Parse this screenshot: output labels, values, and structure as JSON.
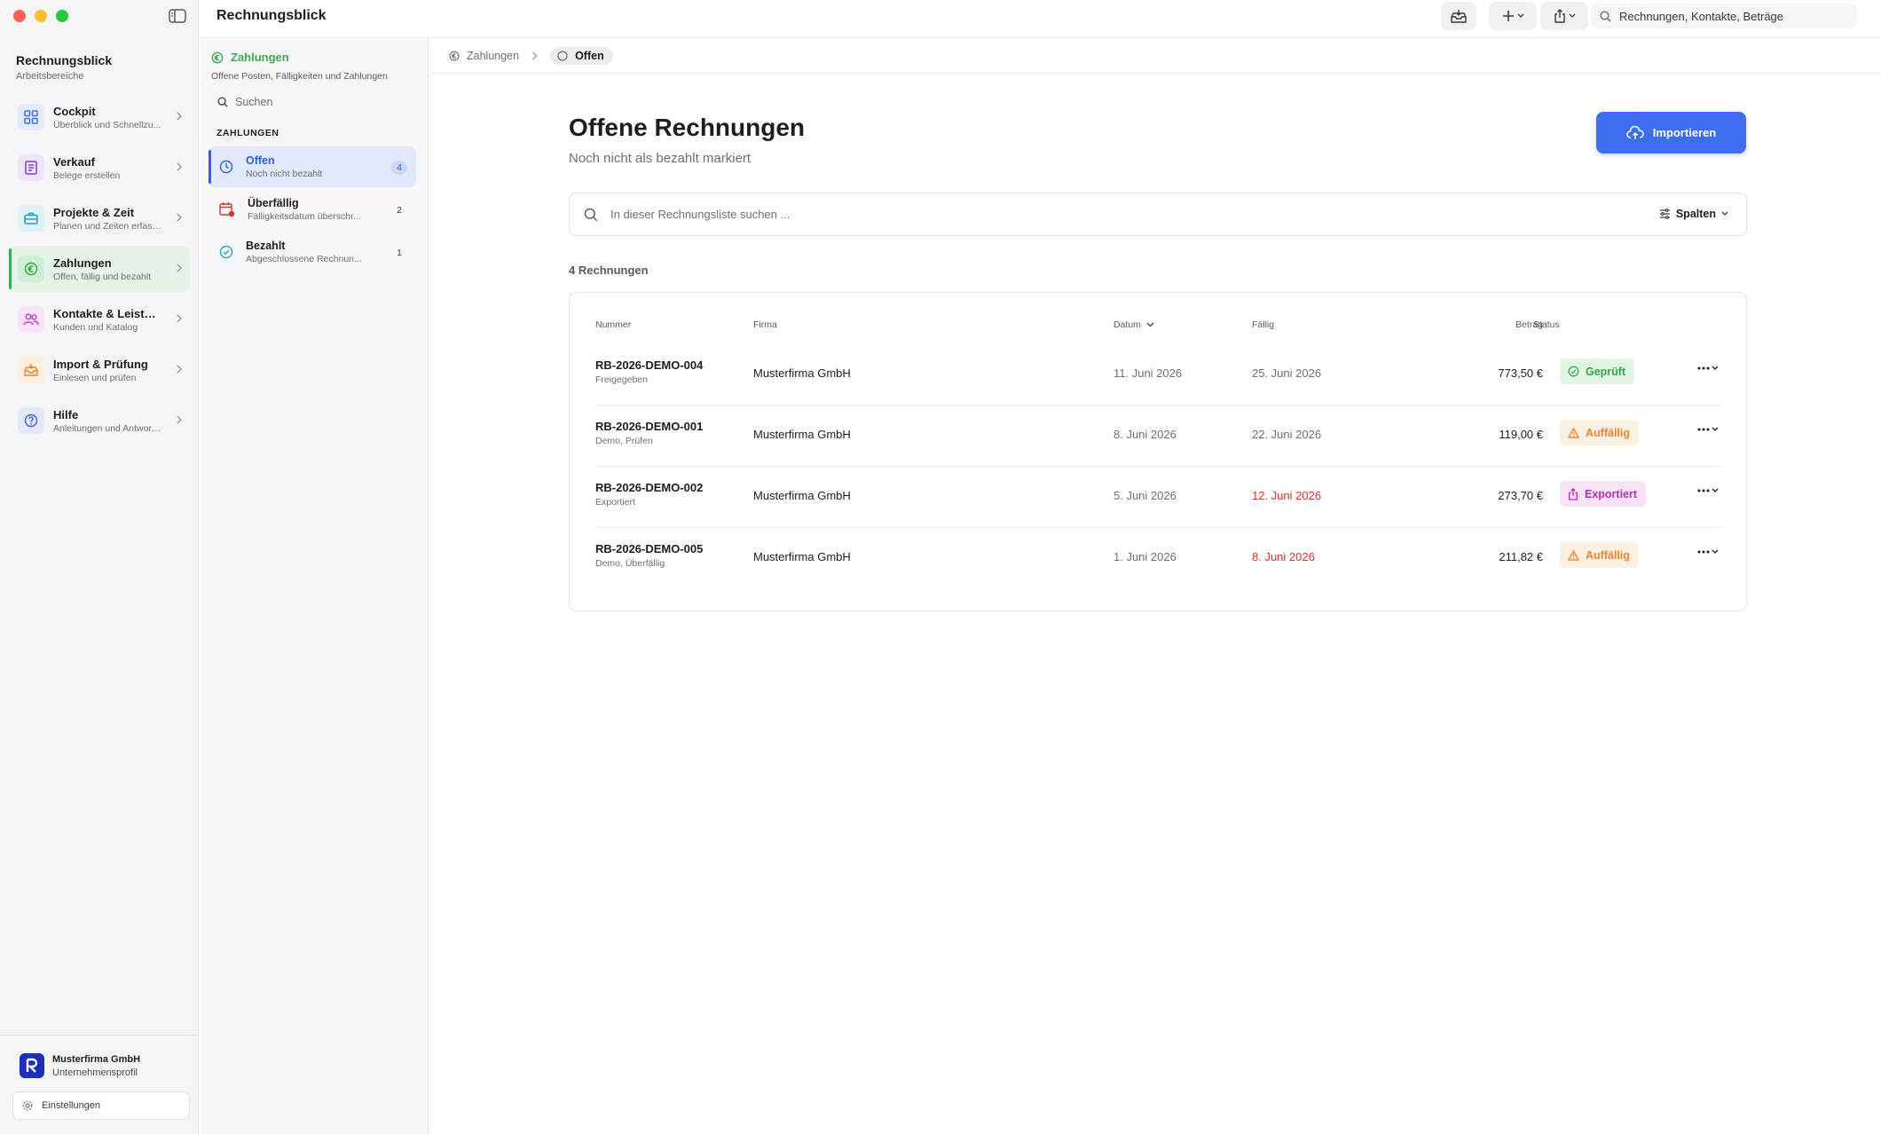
{
  "window": {
    "title": "Rechnungsblick"
  },
  "sidebar": {
    "app_title": "Rechnungsblick",
    "app_subtitle": "Arbeitsbereiche",
    "items": [
      {
        "label": "Cockpit",
        "desc": "Überblick und Schnellzu...",
        "icon": "grid-icon",
        "color": "#3d6ef0"
      },
      {
        "label": "Verkauf",
        "desc": "Belege erstellen",
        "icon": "document-icon",
        "color": "#7a3fcf"
      },
      {
        "label": "Projekte & Zeit",
        "desc": "Planen und Zeiten erfass...",
        "icon": "briefcase-icon",
        "color": "#2aa1b8"
      },
      {
        "label": "Zahlungen",
        "desc": "Offen, fällig und bezahlt",
        "icon": "euro-icon",
        "color": "#3aaa4e"
      },
      {
        "label": "Kontakte & Leistung...",
        "desc": "Kunden und Katalog",
        "icon": "people-icon",
        "color": "#c13acb"
      },
      {
        "label": "Import & Prüfung",
        "desc": "Einlesen und prüfen",
        "icon": "inbox-icon",
        "color": "#e8852b"
      },
      {
        "label": "Hilfe",
        "desc": "Anleitungen und Antwort...",
        "icon": "question-icon",
        "color": "#3d5ae0"
      }
    ],
    "company_name": "Musterfirma GmbH",
    "company_sub": "Unternehmensprofil",
    "settings_label": "Einstellungen"
  },
  "section": {
    "title": "Zahlungen",
    "subtitle": "Offene Posten, Fälligkeiten und Zahlungen",
    "search_placeholder": "Suchen",
    "group_label": "ZAHLUNGEN",
    "items": [
      {
        "label": "Offen",
        "desc": "Noch nicht bezahlt",
        "count": "4"
      },
      {
        "label": "Überfällig",
        "desc": "Fälligkeitsdatum überschr...",
        "count": "2"
      },
      {
        "label": "Bezahlt",
        "desc": "Abgeschlossene Rechnun...",
        "count": "1"
      }
    ]
  },
  "toolbar": {
    "search_placeholder": "Rechnungen, Kontakte, Beträge"
  },
  "breadcrumb": {
    "parent": "Zahlungen",
    "current": "Offen"
  },
  "main": {
    "title": "Offene Rechnungen",
    "subtitle": "Noch nicht als bezahlt markiert",
    "import_label": "Importieren",
    "search_placeholder": "In dieser Rechnungsliste suchen ...",
    "columns_label": "Spalten",
    "count_label": "4 Rechnungen"
  },
  "table": {
    "headers": {
      "number": "Nummer",
      "company": "Firma",
      "date": "Datum",
      "due": "Fällig",
      "amount": "Betrag",
      "status": "Status"
    },
    "rows": [
      {
        "number": "RB-2026-DEMO-004",
        "sub": "Freigegeben",
        "company": "Musterfirma GmbH",
        "date": "11. Juni 2026",
        "due": "25. Juni 2026",
        "amount": "773,50 €",
        "status": "Geprüft"
      },
      {
        "number": "RB-2026-DEMO-001",
        "sub": "Demo, Prüfen",
        "company": "Musterfirma GmbH",
        "date": "8. Juni 2026",
        "due": "22. Juni 2026",
        "amount": "119,00 €",
        "status": "Auffällig"
      },
      {
        "number": "RB-2026-DEMO-002",
        "sub": "Exportiert",
        "company": "Musterfirma GmbH",
        "date": "5. Juni 2026",
        "due": "12. Juni 2026",
        "amount": "273,70 €",
        "status": "Exportiert"
      },
      {
        "number": "RB-2026-DEMO-005",
        "sub": "Demo, Überfällig",
        "company": "Musterfirma GmbH",
        "date": "1. Juni 2026",
        "due": "8. Juni 2026",
        "amount": "211,82 €",
        "status": "Auffällig"
      }
    ]
  },
  "colors": {
    "accent": "#3d6ef0",
    "payments_green": "#3aaa4e",
    "overdue_red": "#d6342c"
  }
}
